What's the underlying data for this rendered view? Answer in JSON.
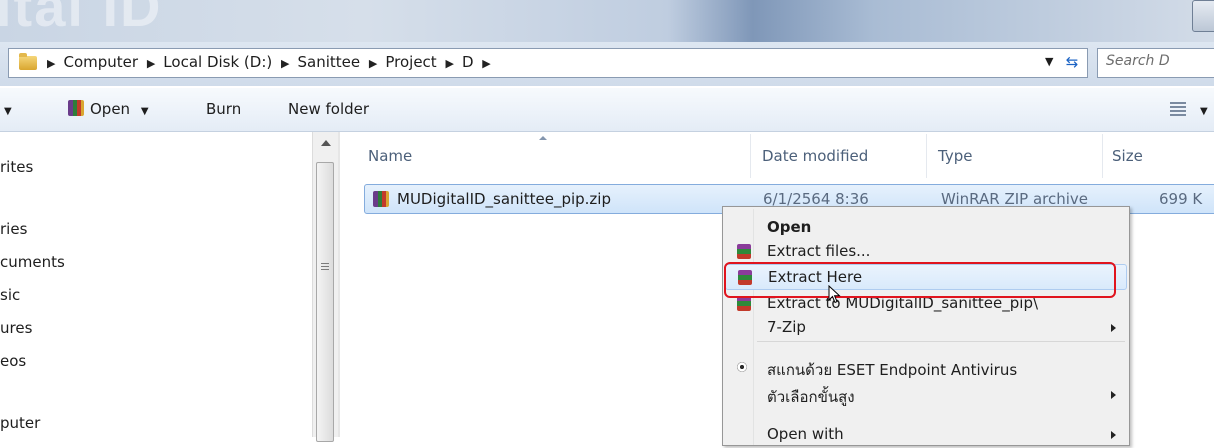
{
  "window": {
    "title_fragment": "ital ID"
  },
  "address_bar": {
    "crumbs": [
      "Computer",
      "Local Disk (D:)",
      "Sanittee",
      "Project",
      "D"
    ],
    "search_placeholder": "Search D"
  },
  "toolbar": {
    "open_label": "Open",
    "burn_label": "Burn",
    "new_folder_label": "New folder"
  },
  "nav": {
    "items": [
      "rites",
      "ries",
      "cuments",
      "sic",
      "ures",
      "eos",
      "puter"
    ]
  },
  "columns": {
    "name": "Name",
    "date_modified": "Date modified",
    "type": "Type",
    "size": "Size"
  },
  "files": [
    {
      "name": "MUDigitalID_sanittee_pip.zip",
      "date_modified": "6/1/2564 8:36",
      "type": "WinRAR ZIP archive",
      "size": "699 K"
    }
  ],
  "context_menu": {
    "items": [
      {
        "label": "Open"
      },
      {
        "label": "Extract files..."
      },
      {
        "label": "Extract Here"
      },
      {
        "label": "Extract to MUDigitalID_sanittee_pip\\"
      },
      {
        "label": "7-Zip"
      },
      {
        "label": "สแกนด้วย ESET Endpoint Antivirus"
      },
      {
        "label": "ตัวเลือกขั้นสูง"
      },
      {
        "label": "Open with"
      }
    ]
  },
  "colors": {
    "annotation_highlight": "#e0141e",
    "selection_bg": "#cfe4fa"
  }
}
